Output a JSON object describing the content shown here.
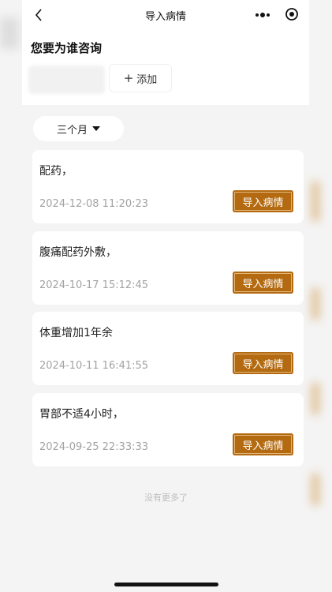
{
  "header": {
    "title": "导入病情",
    "back_icon": "chevron-left-icon",
    "more_icon": "more-dots-icon",
    "record_icon": "target-icon"
  },
  "patient": {
    "title": "您要为谁咨询",
    "add_label": "添加",
    "add_icon": "plus-icon"
  },
  "filter": {
    "selected": "三个月",
    "icon": "caret-down-icon"
  },
  "records": [
    {
      "text": "配药，",
      "time": "2024-12-08 11:20:23",
      "button": "导入病情"
    },
    {
      "text": "腹痛配药外敷，",
      "time": "2024-10-17 15:12:45",
      "button": "导入病情"
    },
    {
      "text": "体重增加1年余",
      "time": "2024-10-11 16:41:55",
      "button": "导入病情"
    },
    {
      "text": "胃部不适4小时，",
      "time": "2024-09-25 22:33:33",
      "button": "导入病情"
    }
  ],
  "footer": {
    "no_more": "没有更多了"
  },
  "colors": {
    "accent": "#b36a10",
    "background": "#f4f4f4",
    "card": "#ffffff",
    "muted_text": "#a3a3a3"
  }
}
